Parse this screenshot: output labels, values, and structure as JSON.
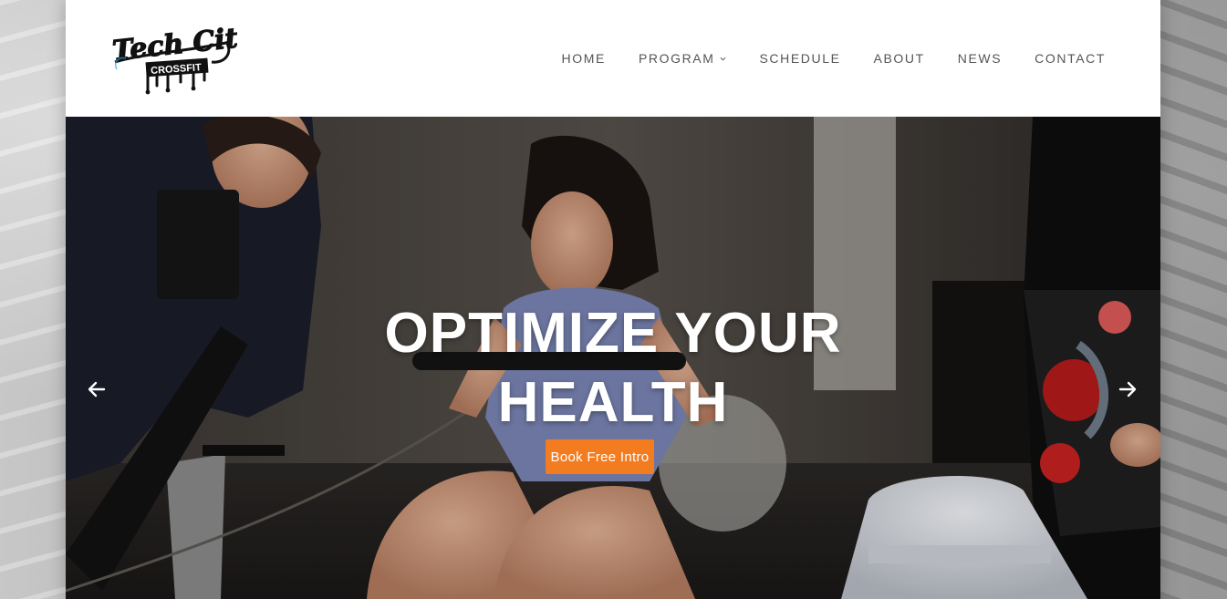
{
  "brand": {
    "logo_script": "Tech City",
    "logo_sub": "CROSSFIT"
  },
  "nav": {
    "items": [
      {
        "label": "HOME"
      },
      {
        "label": "PROGRAM",
        "has_dropdown": true
      },
      {
        "label": "SCHEDULE"
      },
      {
        "label": "ABOUT"
      },
      {
        "label": "NEWS"
      },
      {
        "label": "CONTACT"
      }
    ]
  },
  "hero": {
    "title": "OPTIMIZE YOUR HEALTH",
    "cta_label": "Book Free Intro",
    "prev_icon": "arrow-left-icon",
    "next_icon": "arrow-right-icon"
  },
  "colors": {
    "accent": "#f47c20",
    "nav_text": "#555555",
    "header_bg": "#ffffff",
    "hero_text": "#ffffff"
  }
}
